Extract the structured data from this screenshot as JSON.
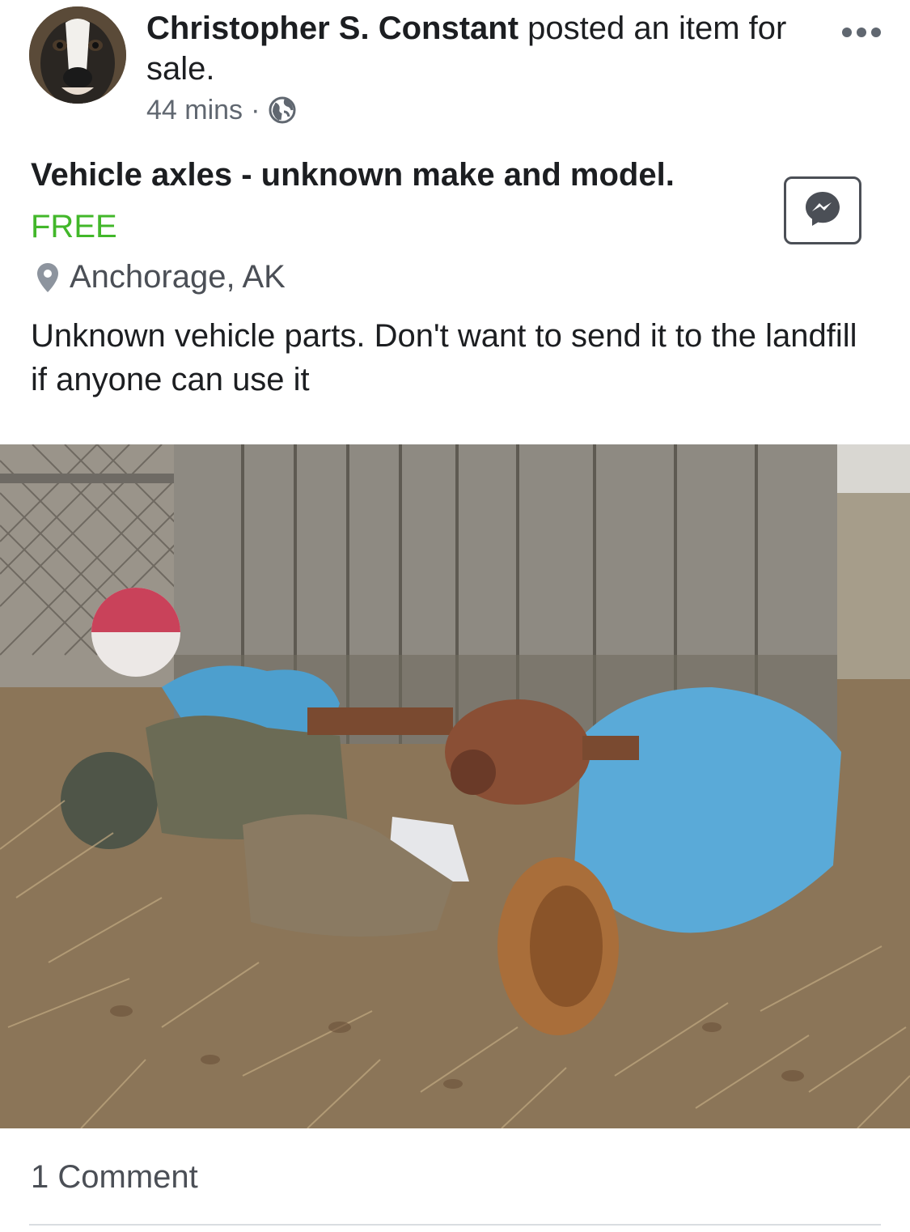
{
  "post": {
    "author": "Christopher S. Constant",
    "action": " posted an item for sale.",
    "time": "44 mins",
    "separator": "·",
    "privacy_icon": "globe-icon",
    "more_icon": "more-options-icon"
  },
  "listing": {
    "title": "Vehicle axles - unknown make and model.",
    "price": "FREE",
    "location": "Anchorage, AK",
    "description": "Unknown vehicle parts. Don't want to send it to the landfill if anyone can use it",
    "message_icon": "messenger-icon"
  },
  "footer": {
    "comments": "1 Comment"
  },
  "colors": {
    "price": "#42b72a",
    "primary_text": "#1c1e21",
    "secondary_text": "#606770"
  }
}
